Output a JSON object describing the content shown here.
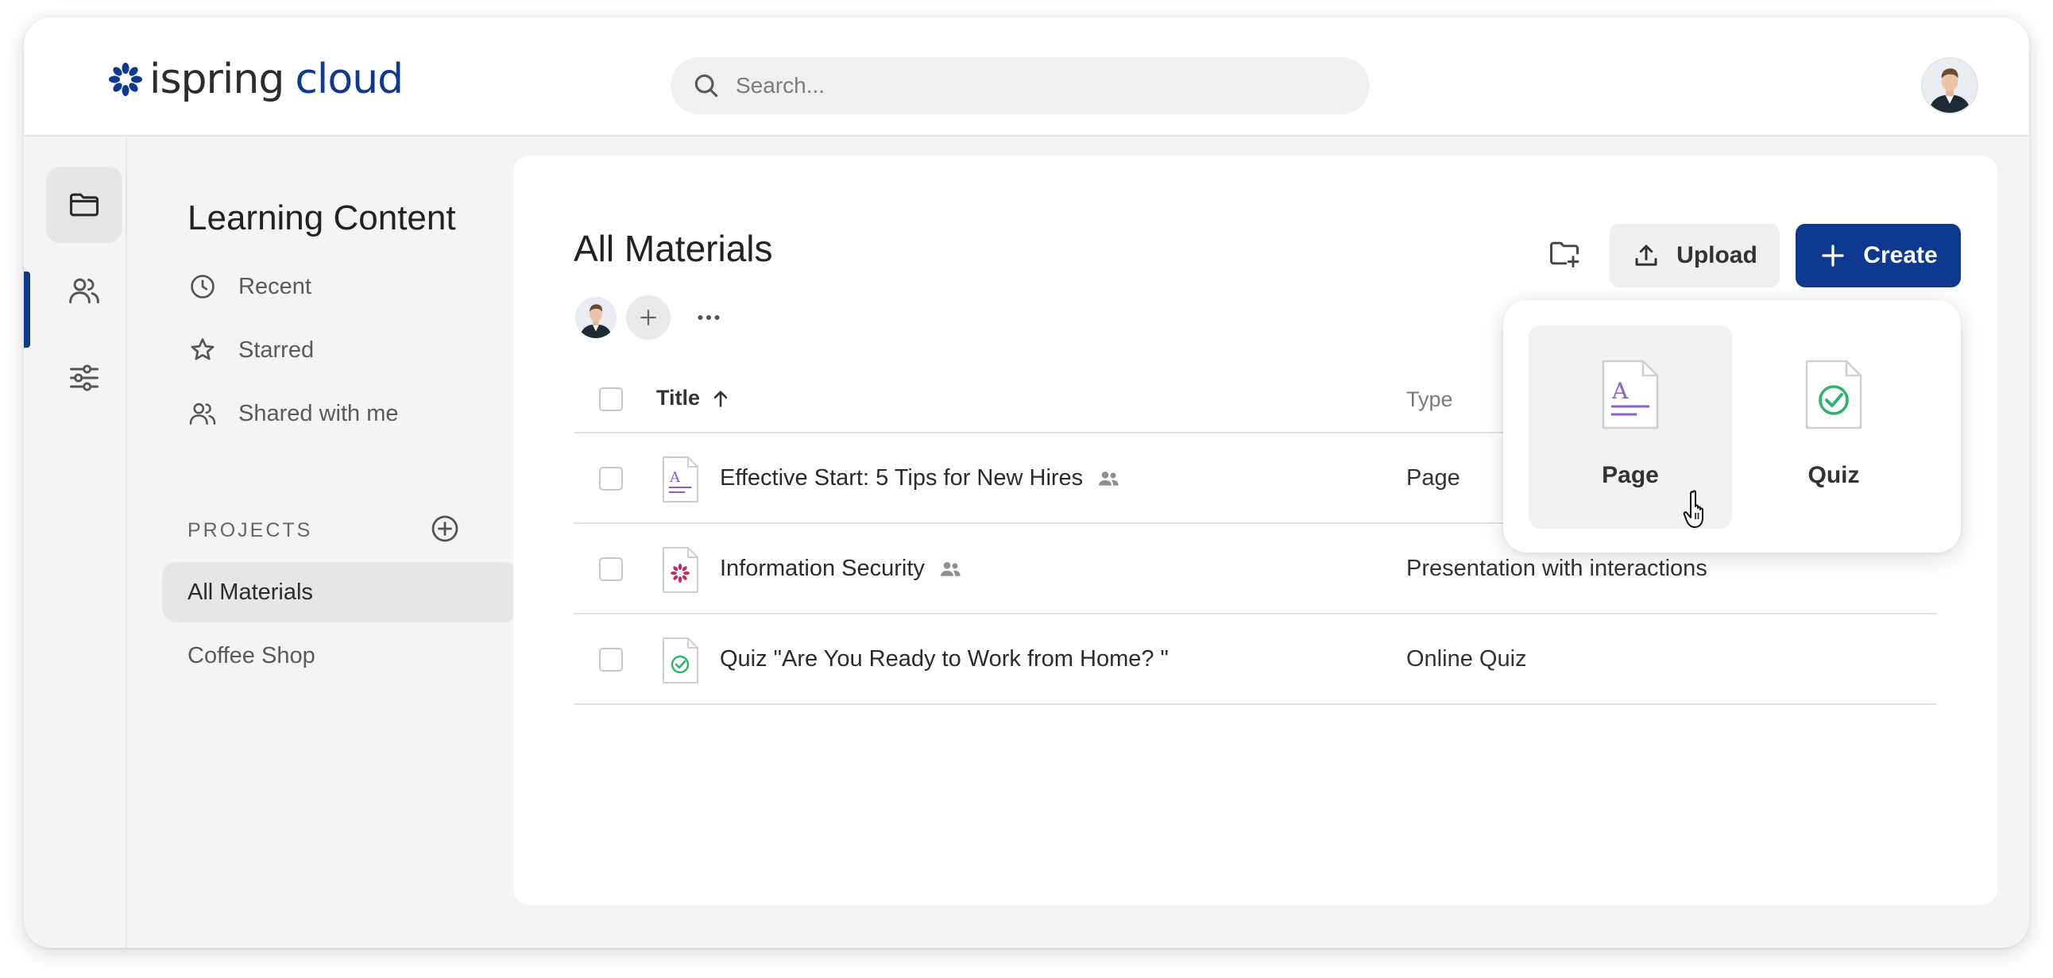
{
  "app": {
    "logo_part1": "ispring",
    "logo_part2": "cloud",
    "brand_color": "#0d3a8f"
  },
  "header": {
    "search_placeholder": "Search..."
  },
  "rail": {
    "items": [
      "folder-icon",
      "users-icon",
      "sliders-icon"
    ],
    "active": "folder-icon"
  },
  "sidebar": {
    "title": "Learning Content",
    "nav": [
      {
        "label": "Recent",
        "icon": "clock-icon"
      },
      {
        "label": "Starred",
        "icon": "star-icon"
      },
      {
        "label": "Shared with me",
        "icon": "users-icon"
      }
    ],
    "projects_label": "PROJECTS",
    "projects": [
      {
        "label": "All Materials",
        "active": true
      },
      {
        "label": "Coffee Shop",
        "active": false
      }
    ]
  },
  "main": {
    "title": "All Materials",
    "upload_label": "Upload",
    "create_label": "Create",
    "columns": {
      "title": "Title",
      "type": "Type"
    },
    "rows": [
      {
        "title": "Effective Start: 5 Tips for New Hires",
        "type": "Page",
        "icon": "page-file-icon",
        "shared": true
      },
      {
        "title": "Information Security",
        "type": "Presentation with interactions",
        "icon": "presentation-file-icon",
        "shared": true
      },
      {
        "title": "Quiz \"Are You Ready to Work from Home? \"",
        "type": "Online Quiz",
        "icon": "quiz-file-icon",
        "shared": false
      }
    ]
  },
  "create_menu": {
    "items": [
      {
        "label": "Page",
        "icon": "page-file-icon"
      },
      {
        "label": "Quiz",
        "icon": "quiz-file-icon"
      }
    ]
  }
}
